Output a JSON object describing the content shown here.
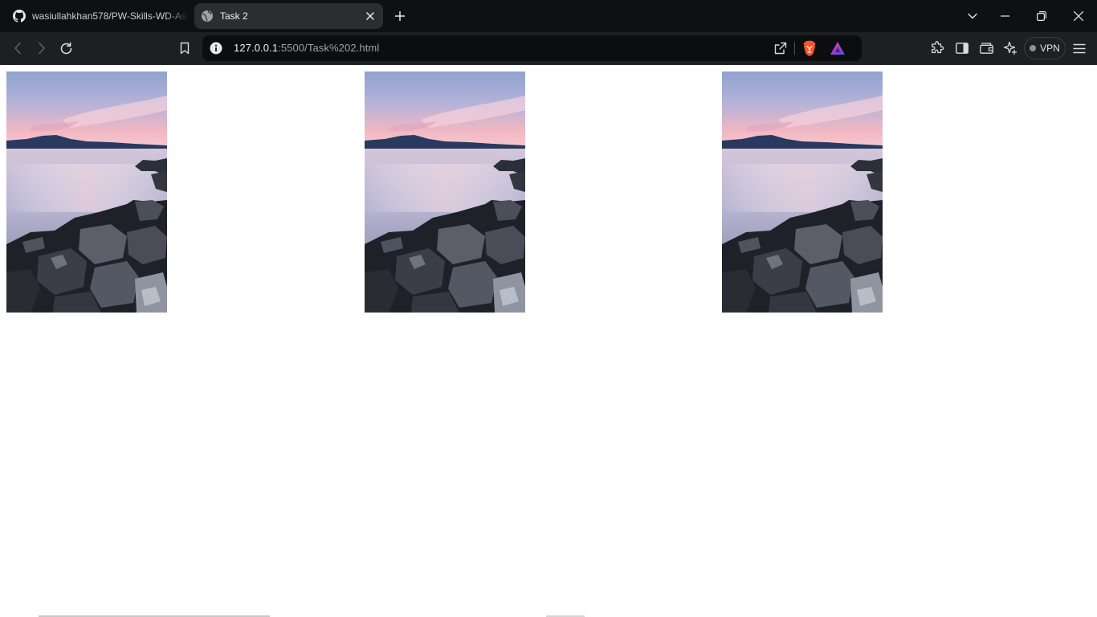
{
  "tabs": [
    {
      "title": "wasiullahkhan578/PW-Skills-WD-As",
      "icon": "github-icon",
      "active": false
    },
    {
      "title": "Task 2",
      "icon": "globe-icon",
      "active": true
    }
  ],
  "address_bar": {
    "host": "127.0.0.1",
    "path": ":5500/Task%202.html"
  },
  "toolbar": {
    "vpn_label": "VPN"
  },
  "page": {
    "images": [
      {
        "alt": "Sunset over a calm lake with dark rocks in the foreground"
      },
      {
        "alt": "Sunset over a calm lake with dark rocks in the foreground"
      },
      {
        "alt": "Sunset over a calm lake with dark rocks in the foreground"
      }
    ]
  },
  "colors": {
    "tabstrip": "#0f1012",
    "toolbar": "#1e1f22",
    "active_tab": "#2b2d31",
    "urlbar": "#0c0d0f",
    "brave_orange": "#fb542b",
    "page_background": "#ffffff"
  }
}
